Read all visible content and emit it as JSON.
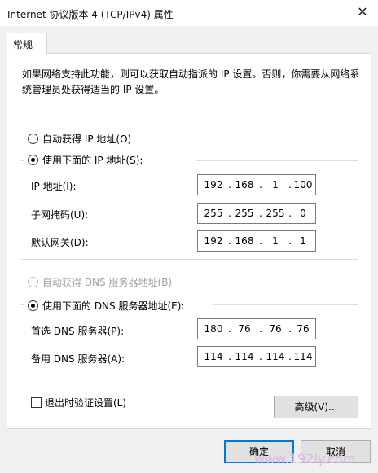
{
  "window": {
    "title": "Internet 协议版本 4 (TCP/IPv4) 属性",
    "close_glyph": "✕"
  },
  "tabs": [
    {
      "label": "常规"
    }
  ],
  "description": "如果网络支持此功能，则可以获取自动指派的 IP 设置。否则，你需要从网络系统管理员处获得适当的 IP 设置。",
  "ip": {
    "auto_label": "自动获得 IP 地址(O)",
    "manual_label": "使用下面的 IP 地址(S):",
    "selected": "manual",
    "fields": [
      {
        "label": "IP 地址(I):",
        "octets": [
          "192",
          "168",
          "1",
          "100"
        ]
      },
      {
        "label": "子网掩码(U):",
        "octets": [
          "255",
          "255",
          "255",
          "0"
        ]
      },
      {
        "label": "默认网关(D):",
        "octets": [
          "192",
          "168",
          "1",
          "1"
        ]
      }
    ]
  },
  "dns": {
    "auto_label": "自动获得 DNS 服务器地址(B)",
    "manual_label": "使用下面的 DNS 服务器地址(E):",
    "selected": "manual",
    "fields": [
      {
        "label": "首选 DNS 服务器(P):",
        "octets": [
          "180",
          "76",
          "76",
          "76"
        ]
      },
      {
        "label": "备用 DNS 服务器(A):",
        "octets": [
          "114",
          "114",
          "114",
          "114"
        ]
      }
    ]
  },
  "validate_on_exit": {
    "label": "退出时验证设置(L)",
    "checked": false
  },
  "buttons": {
    "advanced": "高级(V)...",
    "ok": "确定",
    "cancel": "取消"
  },
  "watermark": "www.192ly.com"
}
